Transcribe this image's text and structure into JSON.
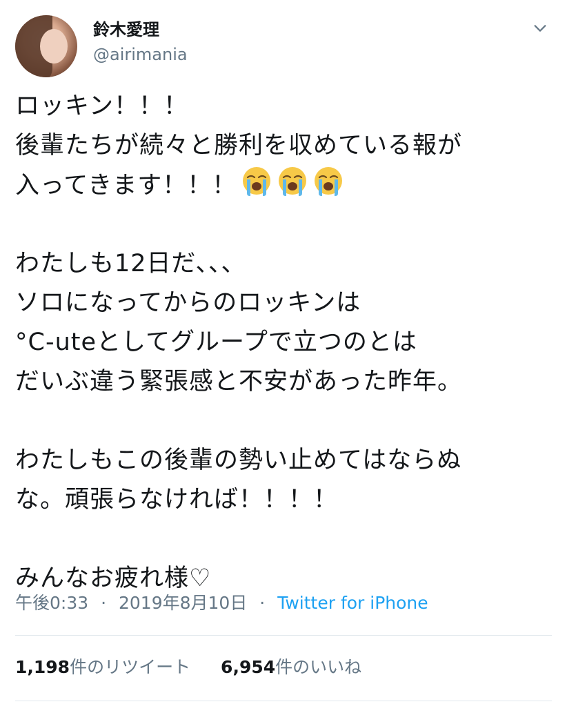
{
  "user": {
    "display_name": "鈴木愛理",
    "handle": "@airimania"
  },
  "tweet": {
    "lines": [
      "ロッキン！！！",
      "後輩たちが続々と勝利を収めている報が",
      "入ってきます！！！",
      "",
      "わたしも12日だ、、、",
      "ソロになってからのロッキンは",
      "°C-uteとしてグループで立つのとは",
      "だいぶ違う緊張感と不安があった昨年。",
      "",
      "わたしもこの後輩の勢い止めてはならぬ",
      "な。頑張らなければ！！！！",
      "",
      "みんなお疲れ様♡"
    ],
    "emoji": [
      "loudly-crying-face",
      "loudly-crying-face",
      "loudly-crying-face"
    ]
  },
  "meta": {
    "time": "午後0:33",
    "date": "2019年8月10日",
    "source": "Twitter for iPhone",
    "separator": "·"
  },
  "stats": {
    "retweets_count": "1,198",
    "retweets_label": "件のリツイート",
    "likes_count": "6,954",
    "likes_label": "件のいいね"
  },
  "colors": {
    "text": "#14171a",
    "secondary": "#657786",
    "link": "#1da1f2",
    "divider": "#e1e8ed"
  }
}
